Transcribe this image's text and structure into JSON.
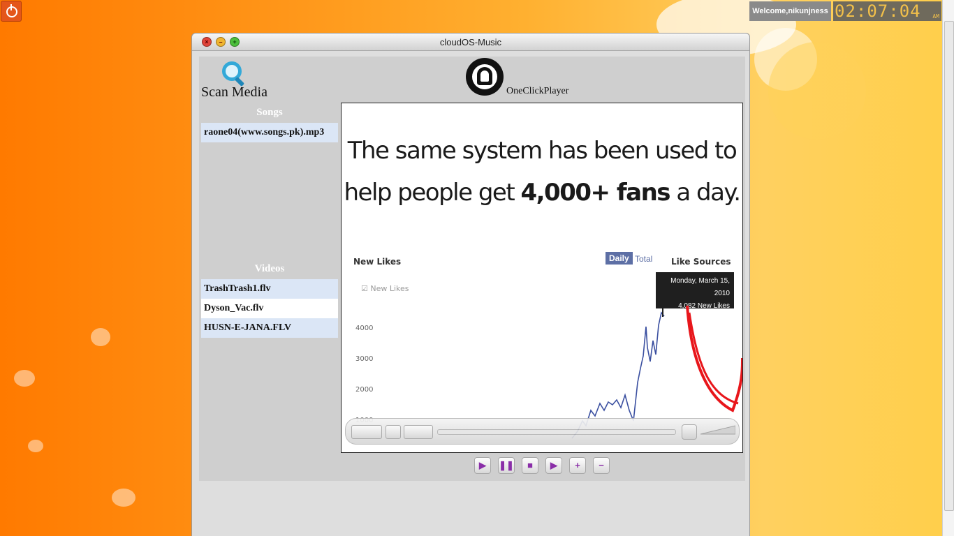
{
  "desktop": {
    "welcome_text": "Welcome,nikunjness",
    "clock_time": "02:07:04",
    "clock_ampm": "AM"
  },
  "window": {
    "title": "cloudOS-Music"
  },
  "app": {
    "scan_label": "Scan Media",
    "player_name": "OneClickPlayer",
    "songs_header": "Songs",
    "videos_header": "Videos",
    "songs": [
      {
        "name": "raone04(www.songs.pk).mp3"
      }
    ],
    "videos": [
      {
        "name": "TrashTrash1.flv"
      },
      {
        "name": "Dyson_Vac.flv"
      },
      {
        "name": "HUSN-E-JANA.FLV"
      }
    ]
  },
  "video_frame": {
    "line1": "The same system has been used to",
    "line2_pre": "help people get ",
    "line2_bold": "4,000+ fans",
    "line2_post": " a day.",
    "new_likes": "New Likes",
    "daily": "Daily",
    "total": "Total",
    "like_sources": "Like Sources",
    "legend_new_likes": "New Likes",
    "tooltip_date": "Monday, March 15, 2010",
    "tooltip_value": "4,082 New Likes",
    "y_ticks": [
      "4000",
      "3000",
      "2000",
      "1000"
    ]
  },
  "transport": {
    "icons": [
      "play-icon",
      "pause-icon",
      "stop-icon",
      "next-icon",
      "plus-icon",
      "minus-icon"
    ]
  },
  "colors": {
    "accent_purple": "#8a2ea8",
    "list_highlight": "#dbe6f6",
    "panel_gray": "#cfcfcf"
  }
}
